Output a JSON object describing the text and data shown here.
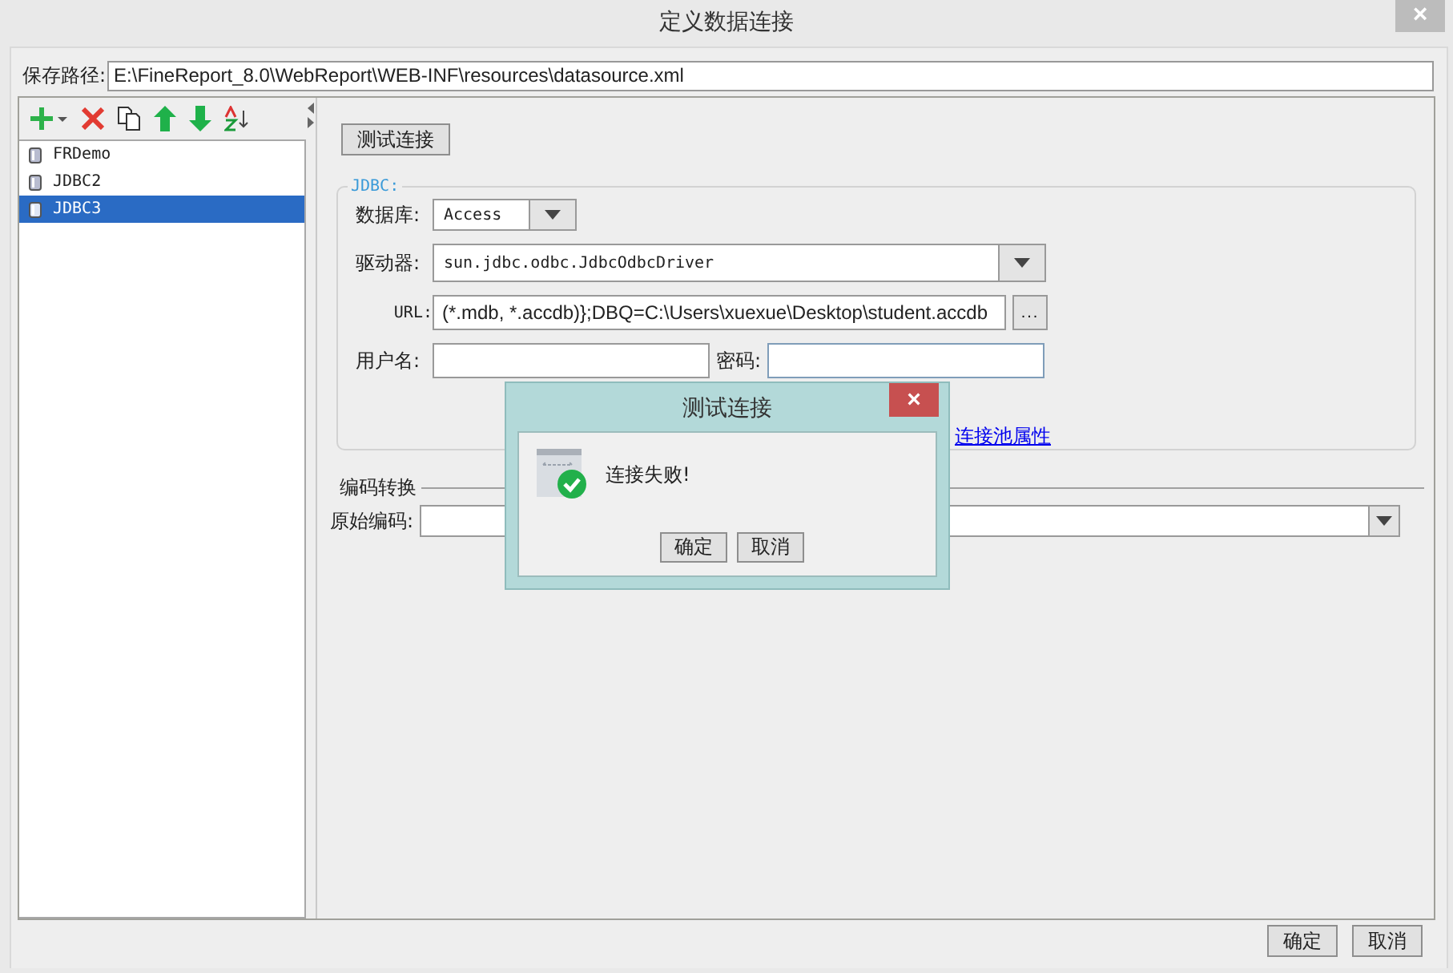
{
  "window": {
    "title": "定义数据连接",
    "close": "×"
  },
  "save_path": {
    "label": "保存路径:",
    "value": "E:\\FineReport_8.0\\WebReport\\WEB-INF\\resources\\datasource.xml"
  },
  "connections": [
    {
      "name": "FRDemo",
      "selected": false
    },
    {
      "name": "JDBC2",
      "selected": false
    },
    {
      "name": "JDBC3",
      "selected": true
    }
  ],
  "test_button": "测试连接",
  "jdbc": {
    "legend": "JDBC:",
    "database": {
      "label": "数据库:",
      "value": "Access"
    },
    "driver": {
      "label": "驱动器:",
      "value": "sun.jdbc.odbc.JdbcOdbcDriver"
    },
    "url": {
      "label": "URL:",
      "value": "(*.mdb, *.accdb)};DBQ=C:\\Users\\xuexue\\Desktop\\student.accdb",
      "browse": "..."
    },
    "username": {
      "label": "用户名:"
    },
    "password": {
      "label": "密码:"
    },
    "pool_link": "连接池属性"
  },
  "encoding": {
    "legend": "编码转换",
    "source": {
      "label": "原始编码:"
    }
  },
  "buttons": [
    "确定",
    "取消"
  ],
  "dialog": {
    "title": "测试连接",
    "close": "×",
    "message": "连接失败!",
    "buttons": [
      "确定",
      "取消"
    ]
  }
}
